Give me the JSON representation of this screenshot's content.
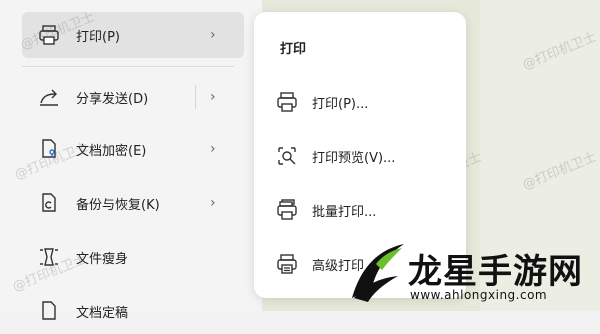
{
  "menu": {
    "items": [
      {
        "label": "打印(P)",
        "icon": "printer-icon",
        "active": true
      },
      {
        "label": "分享发送(D)",
        "icon": "share-icon",
        "active": false
      },
      {
        "label": "文档加密(E)",
        "icon": "document-lock-icon",
        "active": false
      },
      {
        "label": "备份与恢复(K)",
        "icon": "backup-restore-icon",
        "active": false
      },
      {
        "label": "文件瘦身",
        "icon": "file-slim-icon",
        "active": false
      },
      {
        "label": "文档定稿",
        "icon": "document-finalize-icon",
        "active": false
      }
    ]
  },
  "submenu": {
    "title": "打印",
    "items": [
      {
        "label": "打印(P)...",
        "icon": "printer-icon"
      },
      {
        "label": "打印预览(V)...",
        "icon": "print-preview-icon"
      },
      {
        "label": "批量打印...",
        "icon": "batch-print-icon"
      },
      {
        "label": "高级打印",
        "icon": "advanced-print-icon"
      }
    ]
  },
  "watermark": {
    "text": "@打印机卫士"
  },
  "logo": {
    "name": "龙星手游网",
    "url": "www.ahlongxing.com"
  },
  "colors": {
    "backdrop": "#e6e9da",
    "logo_accent": "#6bbf2a"
  }
}
